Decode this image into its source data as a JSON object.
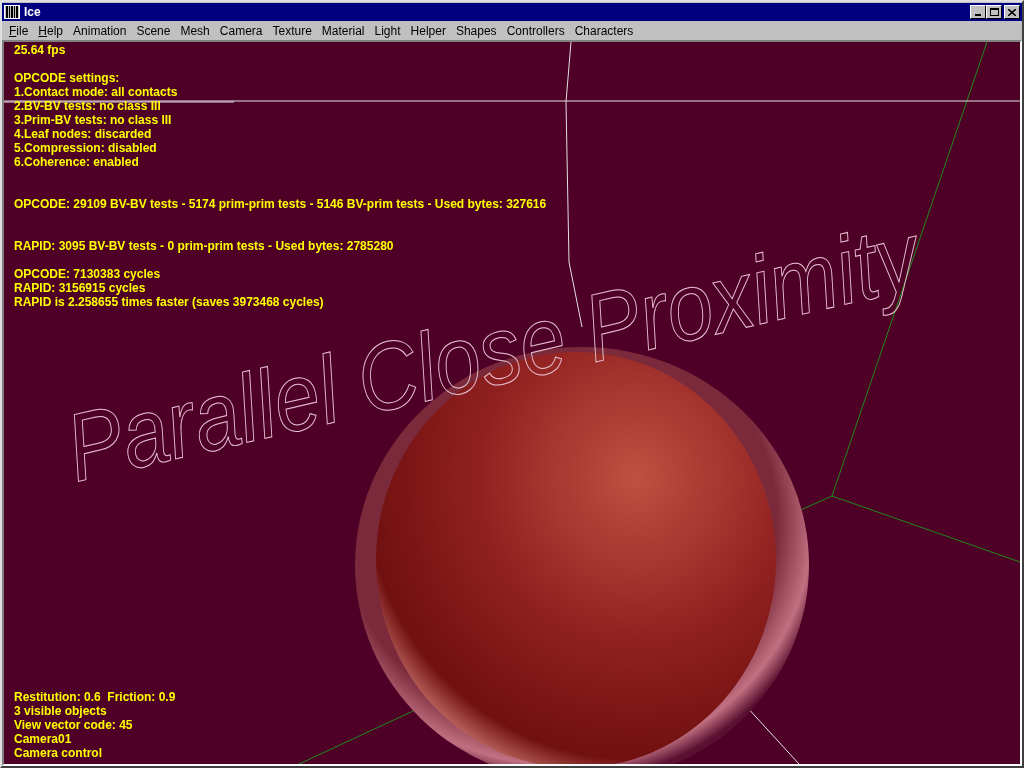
{
  "window": {
    "title": "Ice"
  },
  "menu": [
    {
      "label": "File",
      "mnemonic": true
    },
    {
      "label": "Help",
      "mnemonic": true
    },
    {
      "label": "Animation",
      "mnemonic": false
    },
    {
      "label": "Scene",
      "mnemonic": false
    },
    {
      "label": "Mesh",
      "mnemonic": false
    },
    {
      "label": "Camera",
      "mnemonic": false
    },
    {
      "label": "Texture",
      "mnemonic": false
    },
    {
      "label": "Material",
      "mnemonic": false
    },
    {
      "label": "Light",
      "mnemonic": false
    },
    {
      "label": "Helper",
      "mnemonic": false
    },
    {
      "label": "Shapes",
      "mnemonic": false
    },
    {
      "label": "Controllers",
      "mnemonic": false
    },
    {
      "label": "Characters",
      "mnemonic": false
    }
  ],
  "viewport": {
    "scene_label": "Parallel Close Proximity",
    "top_groups": [
      {
        "lines": [
          "25.64 fps"
        ]
      },
      {
        "wide_gap": false,
        "lines": [
          "OPCODE settings:",
          "1.Contact mode: all contacts",
          "2.BV-BV tests: no class III",
          "3.Prim-BV tests: no class III",
          "4.Leaf nodes: discarded",
          "5.Compression: disabled",
          "6.Coherence: enabled"
        ]
      },
      {
        "wide_gap": true,
        "lines": [
          "OPCODE: 29109 BV-BV tests - 5174 prim-prim tests - 5146 BV-prim tests - Used bytes: 327616"
        ]
      },
      {
        "wide_gap": true,
        "lines": [
          "RAPID: 3095 BV-BV tests - 0 prim-prim tests - Used bytes: 2785280"
        ]
      },
      {
        "wide_gap": false,
        "lines": [
          "OPCODE: 7130383 cycles",
          "RAPID: 3156915 cycles",
          "RAPID is 2.258655 times faster (saves 3973468 cycles)"
        ]
      }
    ],
    "bottom_lines": [
      "Restitution: 0.6  Friction: 0.9",
      "3 visible objects",
      "View vector code: 45",
      "Camera01",
      "Camera control"
    ]
  }
}
